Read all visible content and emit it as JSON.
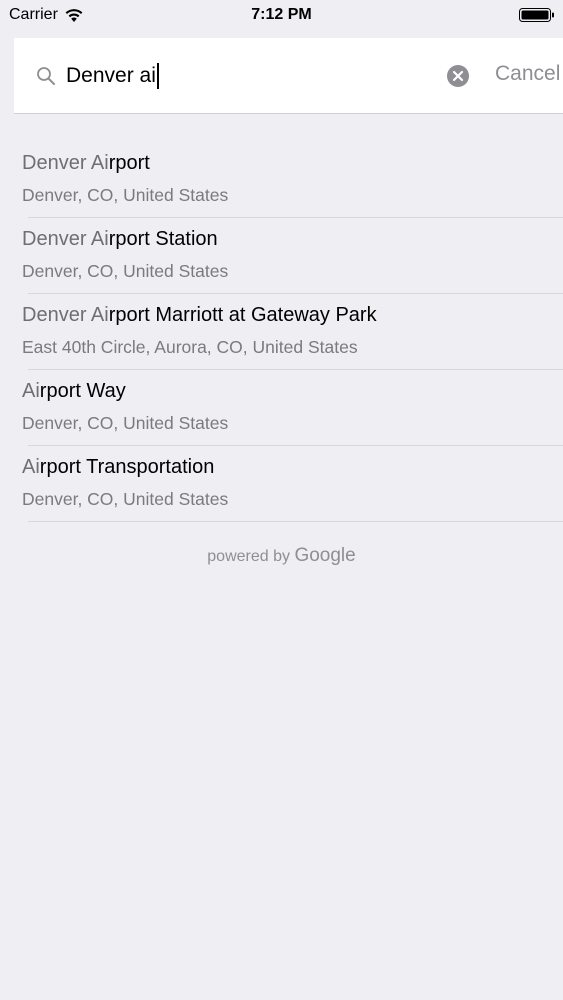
{
  "status_bar": {
    "carrier": "Carrier",
    "time": "7:12 PM"
  },
  "search": {
    "query": "Denver ai",
    "cancel_label": "Cancel"
  },
  "results": [
    {
      "match": "Denver Ai",
      "rest": "rport",
      "subtitle": "Denver, CO, United States"
    },
    {
      "match": "Denver Ai",
      "rest": "rport Station",
      "subtitle": "Denver, CO, United States"
    },
    {
      "match": "Denver Ai",
      "rest": "rport Marriott at Gateway Park",
      "subtitle": "East 40th Circle, Aurora, CO, United States"
    },
    {
      "match": "Ai",
      "rest": "rport Way",
      "subtitle": "Denver, CO, United States"
    },
    {
      "match": "Ai",
      "rest": "rport Transportation",
      "subtitle": "Denver, CO, United States"
    }
  ],
  "footer": {
    "powered_by": "powered by",
    "brand": "Google"
  },
  "colors": {
    "background": "#efeef3",
    "header": "#ffffff",
    "muted": "#8e8e93"
  }
}
